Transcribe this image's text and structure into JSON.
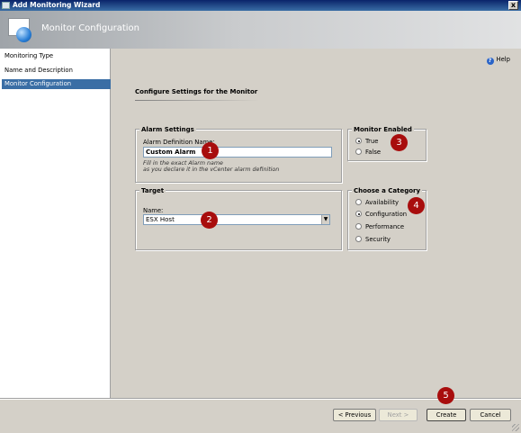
{
  "window": {
    "title": "Add Monitoring Wizard",
    "close_glyph": "x"
  },
  "banner": {
    "title": "Monitor Configuration"
  },
  "sidebar": {
    "items": [
      {
        "label": "Monitoring Type"
      },
      {
        "label": "Name and Description"
      },
      {
        "label": "Monitor Configuration",
        "active": true
      }
    ]
  },
  "main": {
    "help_label": "Help",
    "heading": "Configure Settings for the Monitor",
    "alarm_settings": {
      "legend": "Alarm Settings",
      "field_label": "Alarm Definition Name:",
      "value": "Custom Alarm",
      "hint_line1": "Fill in  the  exact Alarm name",
      "hint_line2": "as you declare it in the vCenter alarm definition"
    },
    "monitor_enabled": {
      "legend": "Monitor Enabled",
      "options": [
        {
          "label": "True",
          "selected": true
        },
        {
          "label": "False",
          "selected": false
        }
      ]
    },
    "target": {
      "legend": "Target",
      "field_label": "Name:",
      "value": "ESX Host"
    },
    "category": {
      "legend": "Choose a Category",
      "options": [
        {
          "label": "Availability",
          "selected": false
        },
        {
          "label": "Configuration",
          "selected": true
        },
        {
          "label": "Performance",
          "selected": false
        },
        {
          "label": "Security",
          "selected": false
        }
      ]
    },
    "callouts": [
      "1",
      "2",
      "3",
      "4",
      "5"
    ]
  },
  "footer": {
    "previous": "< Previous",
    "next": "Next >",
    "create": "Create",
    "cancel": "Cancel"
  },
  "colors": {
    "accent": "#3a6ea5",
    "callout": "#a80d0d"
  },
  "icons": [
    "app-icon",
    "close-icon",
    "monitor-config-logo",
    "help-icon",
    "dropdown-arrow-icon",
    "resize-grip-icon"
  ]
}
